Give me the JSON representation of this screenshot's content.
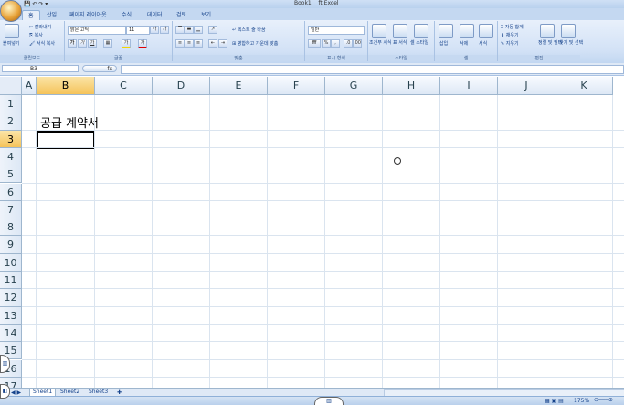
{
  "window": {
    "title_left": "Book1",
    "title_right": "ft Excel"
  },
  "tabs": [
    "홈",
    "삽입",
    "페이지 레이아웃",
    "수식",
    "데이터",
    "검토",
    "보기"
  ],
  "ribbon": {
    "clipboard": {
      "label": "클립보드",
      "paste": "붙여넣기",
      "cut": "잘라내기",
      "copy": "복사",
      "format_painter": "서식 복사"
    },
    "font": {
      "label": "글꼴",
      "font_name": "맑은 고딕",
      "font_size": "11",
      "grow": "가",
      "shrink": "가",
      "bold": "가",
      "italic": "가",
      "underline": "가",
      "fill_color": "가",
      "font_color": "가"
    },
    "alignment": {
      "label": "맞춤",
      "wrap_text": "텍스트 줄 바꿈",
      "merge_center": "병합하고 가운데 맞춤"
    },
    "number": {
      "label": "표시 형식",
      "format": "일반",
      "percent": "%",
      "comma": ","
    },
    "styles": {
      "label": "스타일",
      "conditional": "조건부\n서식",
      "table": "표\n서식",
      "cell_styles": "셀\n스타일"
    },
    "cells": {
      "label": "셀",
      "insert": "삽입",
      "delete": "삭제",
      "format": "서식"
    },
    "editing": {
      "label": "편집",
      "autosum": "자동 합계",
      "fill": "채우기",
      "clear": "지우기",
      "sort": "정렬 및\n필터",
      "find": "찾기 및\n선택"
    }
  },
  "formula_bar": {
    "name_box": "B3",
    "fx": "fx",
    "formula": ""
  },
  "columns": [
    "A",
    "B",
    "C",
    "D",
    "E",
    "F",
    "G",
    "H",
    "I",
    "J",
    "K"
  ],
  "selected_column": "B",
  "rows": [
    "1",
    "2",
    "3",
    "4",
    "5",
    "6",
    "7",
    "8",
    "9",
    "10",
    "11",
    "12",
    "13",
    "14",
    "15",
    "16",
    "17"
  ],
  "selected_row": "3",
  "cells": {
    "B2": "공급 계약서"
  },
  "sheets": [
    "Sheet1",
    "Sheet2",
    "Sheet3"
  ],
  "active_sheet": "Sheet1",
  "status": {
    "zoom": "175%"
  }
}
